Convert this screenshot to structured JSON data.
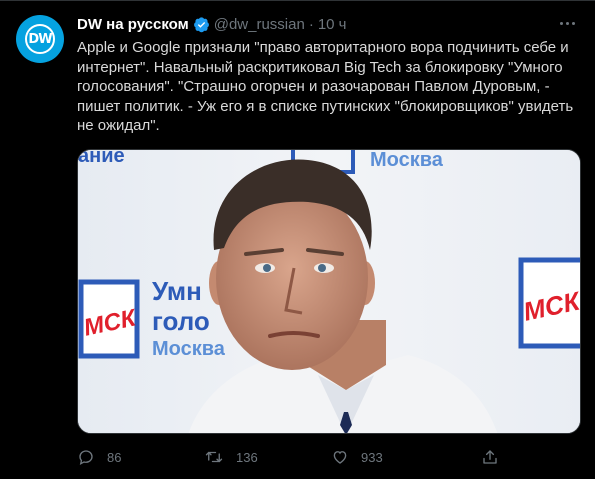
{
  "author": {
    "display_name": "DW на русском",
    "handle": "@dw_russian",
    "time": "10 ч",
    "avatar_text": "DW",
    "verified": true
  },
  "tweet": {
    "text": "Apple и Google признали \"право авторитарного вора подчинить себе и интернет\". Навальный раскритиковал Big Tech за блокировку \"Умного голосования\". \"Страшно огорчен и разочарован Павлом Дуровым, - пишет политик. - Уж его я в списке путинских \"блокировщиков\" увидеть не ожидал\"."
  },
  "media": {
    "backdrop": {
      "top_left": "ание",
      "top_center": "Москва",
      "logo": "МСК",
      "left_lines": [
        "Умн",
        "голо",
        "Москва"
      ]
    }
  },
  "actions": {
    "replies": "86",
    "retweets": "136",
    "likes": "933"
  },
  "colors": {
    "background": "#000000",
    "text": "#d9d9d9",
    "secondary": "#6e767d",
    "verified": "#1d9bf0",
    "avatar": "#05a2e0"
  }
}
